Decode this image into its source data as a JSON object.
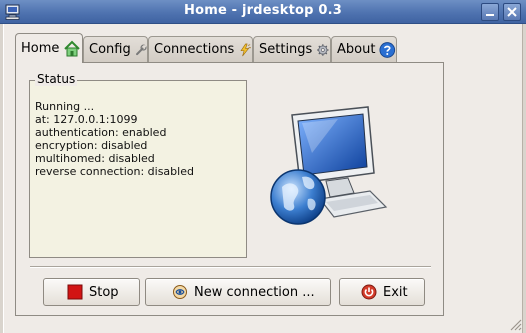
{
  "window": {
    "title": "Home - jrdesktop 0.3",
    "app_icon": "computer-icon",
    "controls": [
      "minimize-icon",
      "close-icon"
    ]
  },
  "tabs": [
    {
      "label": "Home",
      "icon": "house-icon",
      "active": true
    },
    {
      "label": "Config",
      "icon": "wrench-icon"
    },
    {
      "label": "Connections",
      "icon": "lightning-icon"
    },
    {
      "label": "Settings",
      "icon": "gear-icon"
    },
    {
      "label": "About",
      "icon": "help-icon"
    }
  ],
  "status": {
    "legend": "Status",
    "lines": [
      "Running ...",
      "at: 127.0.0.1:1099",
      "authentication: enabled",
      "encryption: disabled",
      "multihomed: disabled",
      "reverse connection: disabled"
    ]
  },
  "hero": {
    "icon": "network-computer-globe-icon"
  },
  "buttons": {
    "stop": {
      "label": "Stop",
      "icon": "stop-icon"
    },
    "new_connection": {
      "label": "New connection ...",
      "icon": "connect-icon"
    },
    "exit": {
      "label": "Exit",
      "icon": "power-icon"
    }
  },
  "colors": {
    "titlebar": "#4f73b0",
    "window_bg": "#efebe7",
    "status_bg": "#f3f2e2",
    "stop_red": "#d21414",
    "exit_red": "#d33b2a"
  }
}
